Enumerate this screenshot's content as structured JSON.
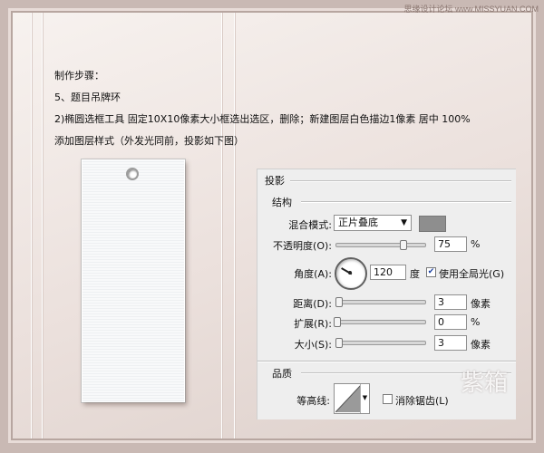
{
  "watermark": "思缘设计论坛 www.MISSYUAN.COM",
  "tutorial": {
    "heading": "制作步骤：",
    "step": "5、题目吊牌环",
    "line1": "2)椭圆选框工具 固定10X10像素大小框选出选区，删除；新建图层白色描边1像素 居中 100%",
    "line2": "添加图层样式（外发光同前，投影如下图）"
  },
  "panel": {
    "title": "投影",
    "structure_heading": "结构",
    "blend_mode_label": "混合模式:",
    "blend_mode_value": "正片叠底",
    "shadow_color": "#8e8e8e",
    "opacity_label": "不透明度(O):",
    "opacity_value": "75",
    "opacity_unit": "%",
    "opacity_level": 0.75,
    "angle_label": "角度(A):",
    "angle_value": "120",
    "angle_unit": "度",
    "global_light_label": "使用全局光(G)",
    "global_light_checked": true,
    "distance_label": "距离(D):",
    "distance_value": "3",
    "distance_unit": "像素",
    "spread_label": "扩展(R):",
    "spread_value": "0",
    "spread_unit": "%",
    "size_label": "大小(S):",
    "size_value": "3",
    "size_unit": "像素",
    "quality_heading": "品质",
    "contour_label": "等高线:",
    "antialias_label": "消除锯齿(L)",
    "antialias_checked": false
  },
  "logo_text": "紫箱"
}
